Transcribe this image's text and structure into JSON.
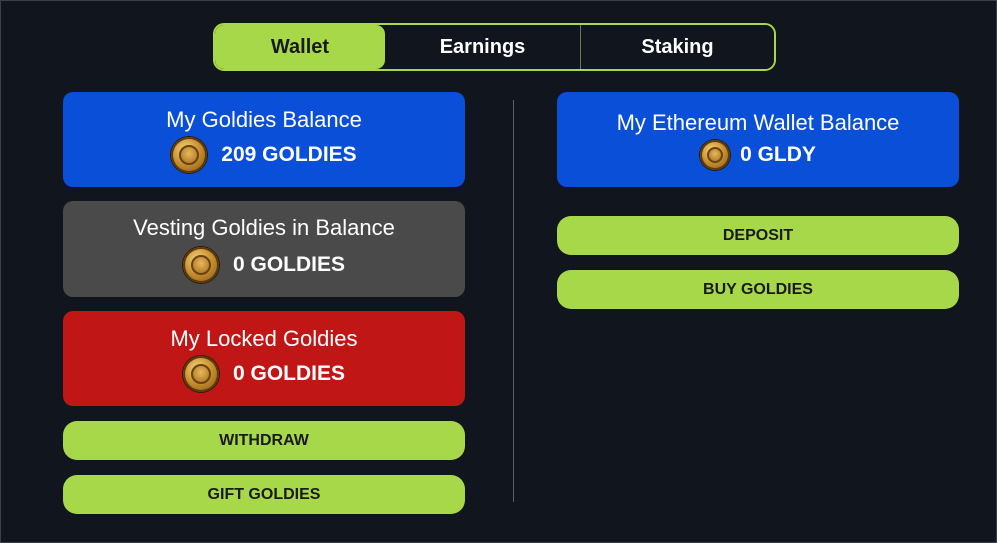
{
  "tabs": [
    {
      "label": "Wallet",
      "active": true
    },
    {
      "label": "Earnings",
      "active": false
    },
    {
      "label": "Staking",
      "active": false
    }
  ],
  "left": {
    "goldies_balance": {
      "title": "My Goldies Balance",
      "amount": "209 GOLDIES",
      "color": "#0a4fd8"
    },
    "vesting": {
      "title": "Vesting Goldies in Balance",
      "amount": "0 GOLDIES",
      "color": "#4a4a4a"
    },
    "locked": {
      "title": "My Locked Goldies",
      "amount": "0 GOLDIES",
      "color": "#c01616"
    },
    "withdraw_label": "WITHDRAW",
    "gift_label": "GIFT GOLDIES"
  },
  "right": {
    "eth_balance": {
      "title": "My Ethereum Wallet Balance",
      "amount": "0 GLDY",
      "color": "#0a4fd8"
    },
    "deposit_label": "DEPOSIT",
    "buy_label": "BUY GOLDIES"
  },
  "colors": {
    "accent": "#a6d84a",
    "background": "#11151d"
  },
  "icons": {
    "coin": "goldies-coin-icon"
  }
}
